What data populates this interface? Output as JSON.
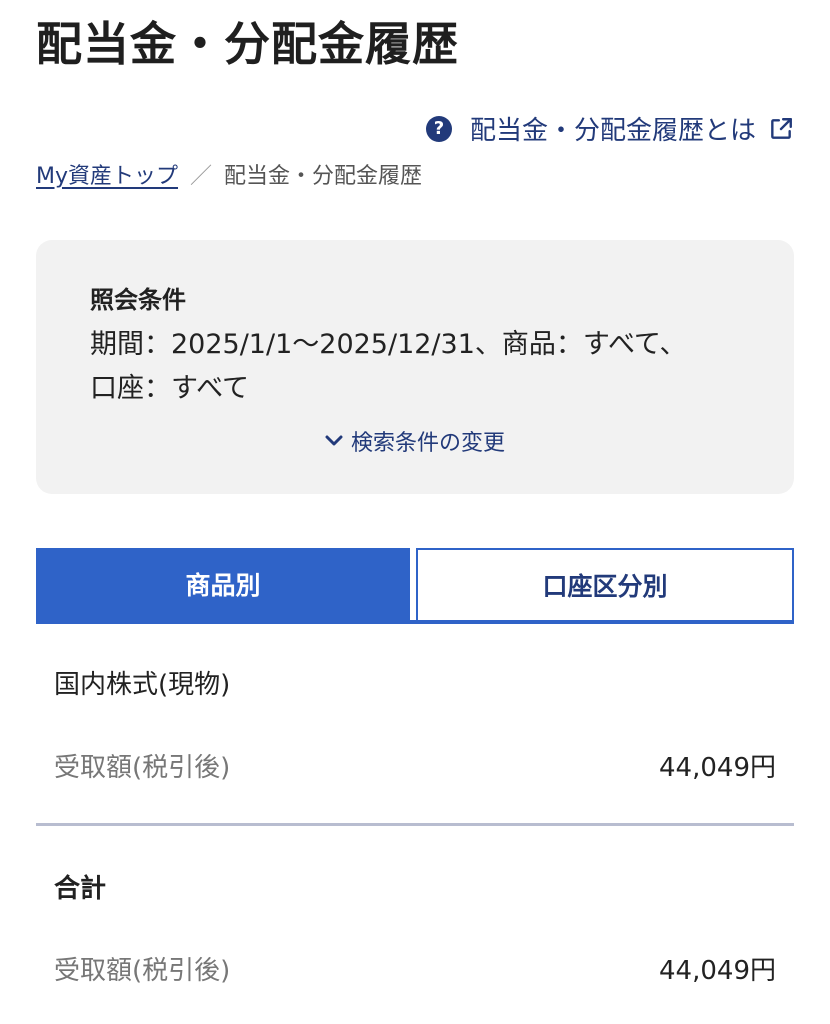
{
  "header": {
    "title": "配当金・分配金履歴"
  },
  "help": {
    "icon": "question-circle-icon",
    "label": "配当金・分配金履歴とは",
    "external_icon": "external-link-icon"
  },
  "breadcrumb": {
    "home": "My資産トップ",
    "separator": "／",
    "current": "配当金・分配金履歴"
  },
  "conditions": {
    "heading": "照会条件",
    "line1": "期間：2025/1/1〜2025/12/31、商品：すべて、",
    "line2": "口座：すべて",
    "change_label": "検索条件の変更",
    "change_icon": "chevron-down-icon"
  },
  "tabs": [
    {
      "label": "商品別",
      "active": true
    },
    {
      "label": "口座区分別",
      "active": false
    }
  ],
  "sections": [
    {
      "title": "国内株式(現物)",
      "rows": [
        {
          "label": "受取額(税引後)",
          "value": "44,049円"
        }
      ]
    }
  ],
  "total": {
    "title": "合計",
    "rows": [
      {
        "label": "受取額(税引後)",
        "value": "44,049円"
      }
    ]
  },
  "colors": {
    "accent": "#2f63c8",
    "link": "#223a7a",
    "panel_bg": "#f2f2f2",
    "divider": "#b8bdd0"
  }
}
